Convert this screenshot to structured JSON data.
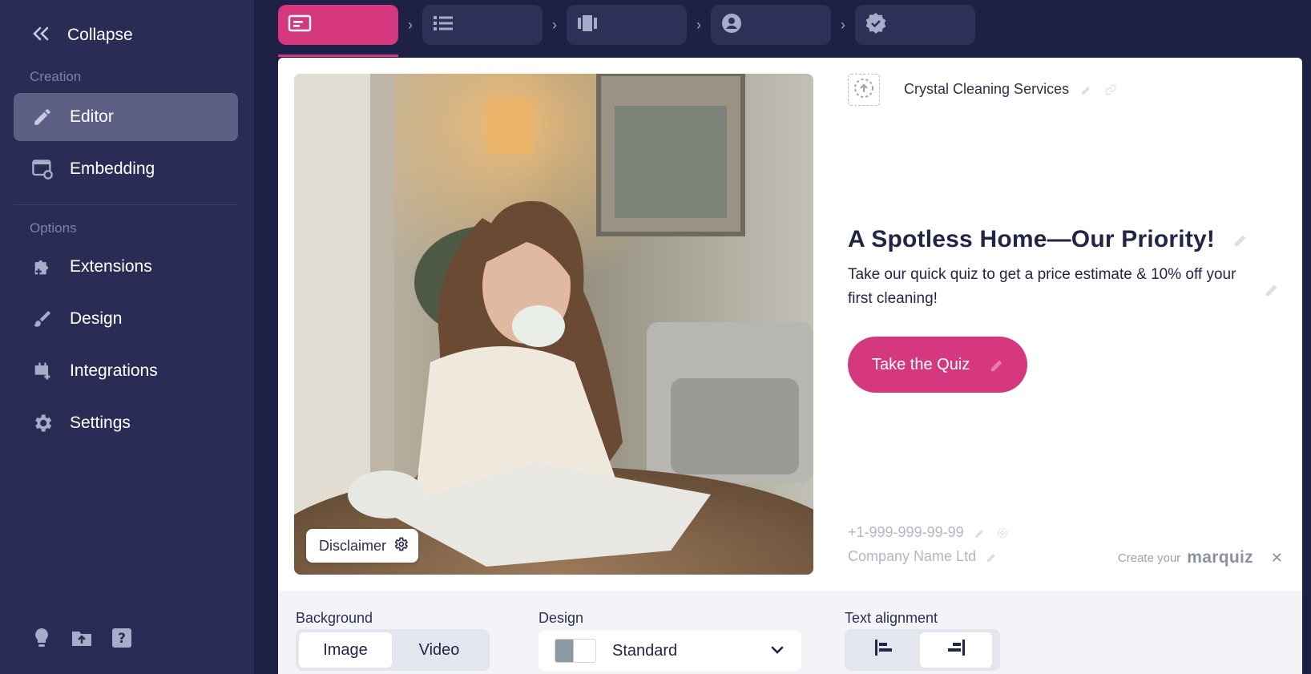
{
  "sidebar": {
    "collapse_label": "Collapse",
    "sections": [
      {
        "label": "Creation"
      },
      {
        "label": "Options"
      }
    ],
    "items": [
      {
        "label": "Editor",
        "icon": "pencil-icon",
        "active": true
      },
      {
        "label": "Embedding",
        "icon": "embed-gear-icon"
      },
      {
        "label": "Extensions",
        "icon": "puzzle-add-icon"
      },
      {
        "label": "Design",
        "icon": "brush-icon"
      },
      {
        "label": "Integrations",
        "icon": "plug-add-icon"
      },
      {
        "label": "Settings",
        "icon": "gear-icon"
      }
    ],
    "bottom_icons": [
      "lightbulb-icon",
      "folder-upload-icon",
      "help-icon"
    ]
  },
  "steps": [
    {
      "icon": "start-page-icon",
      "active": true
    },
    {
      "icon": "list-icon"
    },
    {
      "icon": "cards-icon"
    },
    {
      "icon": "contact-icon"
    },
    {
      "icon": "verified-icon"
    }
  ],
  "preview": {
    "company_top": "Crystal Cleaning Services",
    "headline": "A Spotless Home—Our Priority!",
    "subtext": "Take our quick quiz to get a price estimate & 10% off your first cleaning!",
    "cta_label": "Take the Quiz",
    "disclaimer_label": "Disclaimer",
    "phone": "+1-999-999-99-99",
    "company_name": "Company Name Ltd",
    "brand_prefix": "Create your",
    "brand_name": "marquiz",
    "photo_description_icon": "cover-photo"
  },
  "settings": {
    "background_label": "Background",
    "background_options": [
      "Image",
      "Video"
    ],
    "background_selected": "Image",
    "design_label": "Design",
    "design_value": "Standard",
    "alignment_label": "Text alignment",
    "alignment_options": [
      "align-left-icon",
      "align-right-icon"
    ],
    "alignment_selected": "align-right-icon"
  },
  "colors": {
    "sidebar_bg": "#2b2c56",
    "page_bg": "#1f2046",
    "accent": "#d6387f",
    "active_nav": "#5e5f84"
  }
}
